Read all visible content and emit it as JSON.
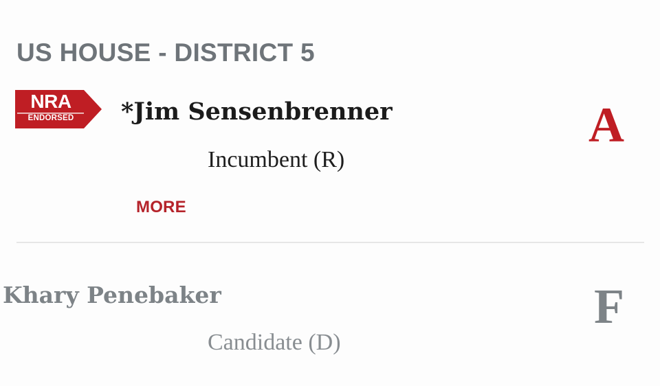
{
  "race": {
    "title": "US HOUSE - DISTRICT 5"
  },
  "colors": {
    "nra_red": "#bf1e24",
    "title_gray": "#6e7479",
    "muted_gray": "#7d8387"
  },
  "candidates": [
    {
      "name": "*Jim Sensenbrenner",
      "status": "Incumbent (R)",
      "grade": "A",
      "badge": {
        "top": "NRA",
        "bottom": "ENDORSED",
        "icon": "nra-endorsed-badge-icon"
      },
      "more_label": "MORE"
    },
    {
      "name": "Khary Penebaker",
      "status": "Candidate (D)",
      "grade": "F"
    }
  ]
}
